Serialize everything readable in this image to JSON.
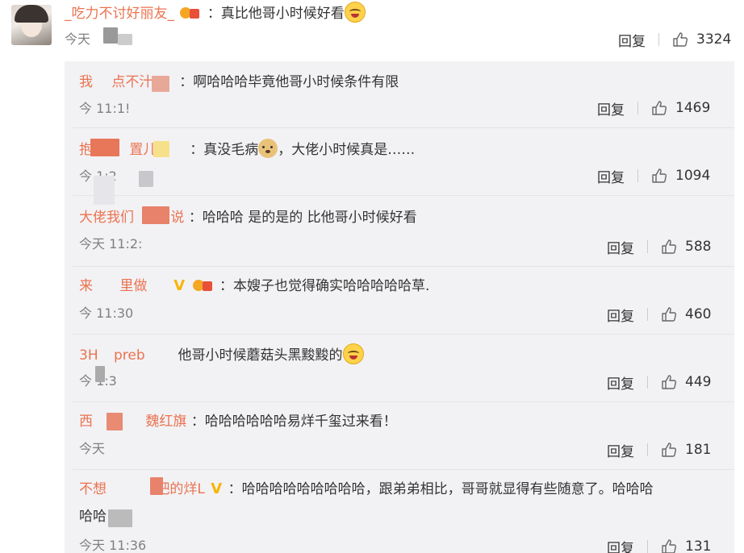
{
  "main_comment": {
    "username": "_吃力不讨好丽友_",
    "text": "：真比他哥小时候好看",
    "time": "今天",
    "reply_label": "回复",
    "like_count": "3324"
  },
  "replies": [
    {
      "username": "我",
      "username_tail": "点不汁",
      "text": "：啊哈哈哈毕竟他哥小时候条件有限",
      "time": "今 11:1!",
      "reply_label": "回复",
      "like_count": "1469"
    },
    {
      "username": "抱",
      "username_tail": "置儿",
      "text": "：真没毛病",
      "text_after": "，大佬小时候真是……",
      "time": "今 1:2",
      "reply_label": "回复",
      "like_count": "1094"
    },
    {
      "username": "大佬我们",
      "username_tail": "说",
      "text": "：哈哈哈 是的是的 比他哥小时候好看",
      "time": "今天 11:2:",
      "reply_label": "回复",
      "like_count": "588"
    },
    {
      "username": "来",
      "username_tail": "里做",
      "text": "：本嫂子也觉得确实哈哈哈哈哈草.",
      "time": "今 11:30",
      "reply_label": "回复",
      "like_count": "460"
    },
    {
      "username": "3H",
      "username_tail": "preb",
      "text": "他哥小时候蘑菇头黑黢黢的",
      "time": "今 1:3",
      "reply_label": "回复",
      "like_count": "449"
    },
    {
      "username": "西",
      "username_tail": "魏红旗",
      "text": "：哈哈哈哈哈哈易烊千玺过来看！",
      "time": "今天",
      "reply_label": "回复",
      "like_count": "181"
    },
    {
      "username": "不想",
      "username_tail": "吧的烊L",
      "text": "：哈哈哈哈哈哈哈哈哈，跟弟弟相比，哥哥就显得有些随意了。哈哈哈",
      "text_line2": "哈哈",
      "time": "今天 11:36",
      "reply_label": "回复",
      "like_count": "131"
    }
  ],
  "colors": {
    "username": "#eb7350",
    "text": "#333333",
    "meta": "#808080",
    "panel_bg": "#f2f2f5",
    "vip": "#f7b500"
  },
  "icons": [
    "thumbs-up-icon",
    "vip-icon",
    "badge-icon",
    "laughing-emoji-icon",
    "dog-emoji-icon"
  ]
}
